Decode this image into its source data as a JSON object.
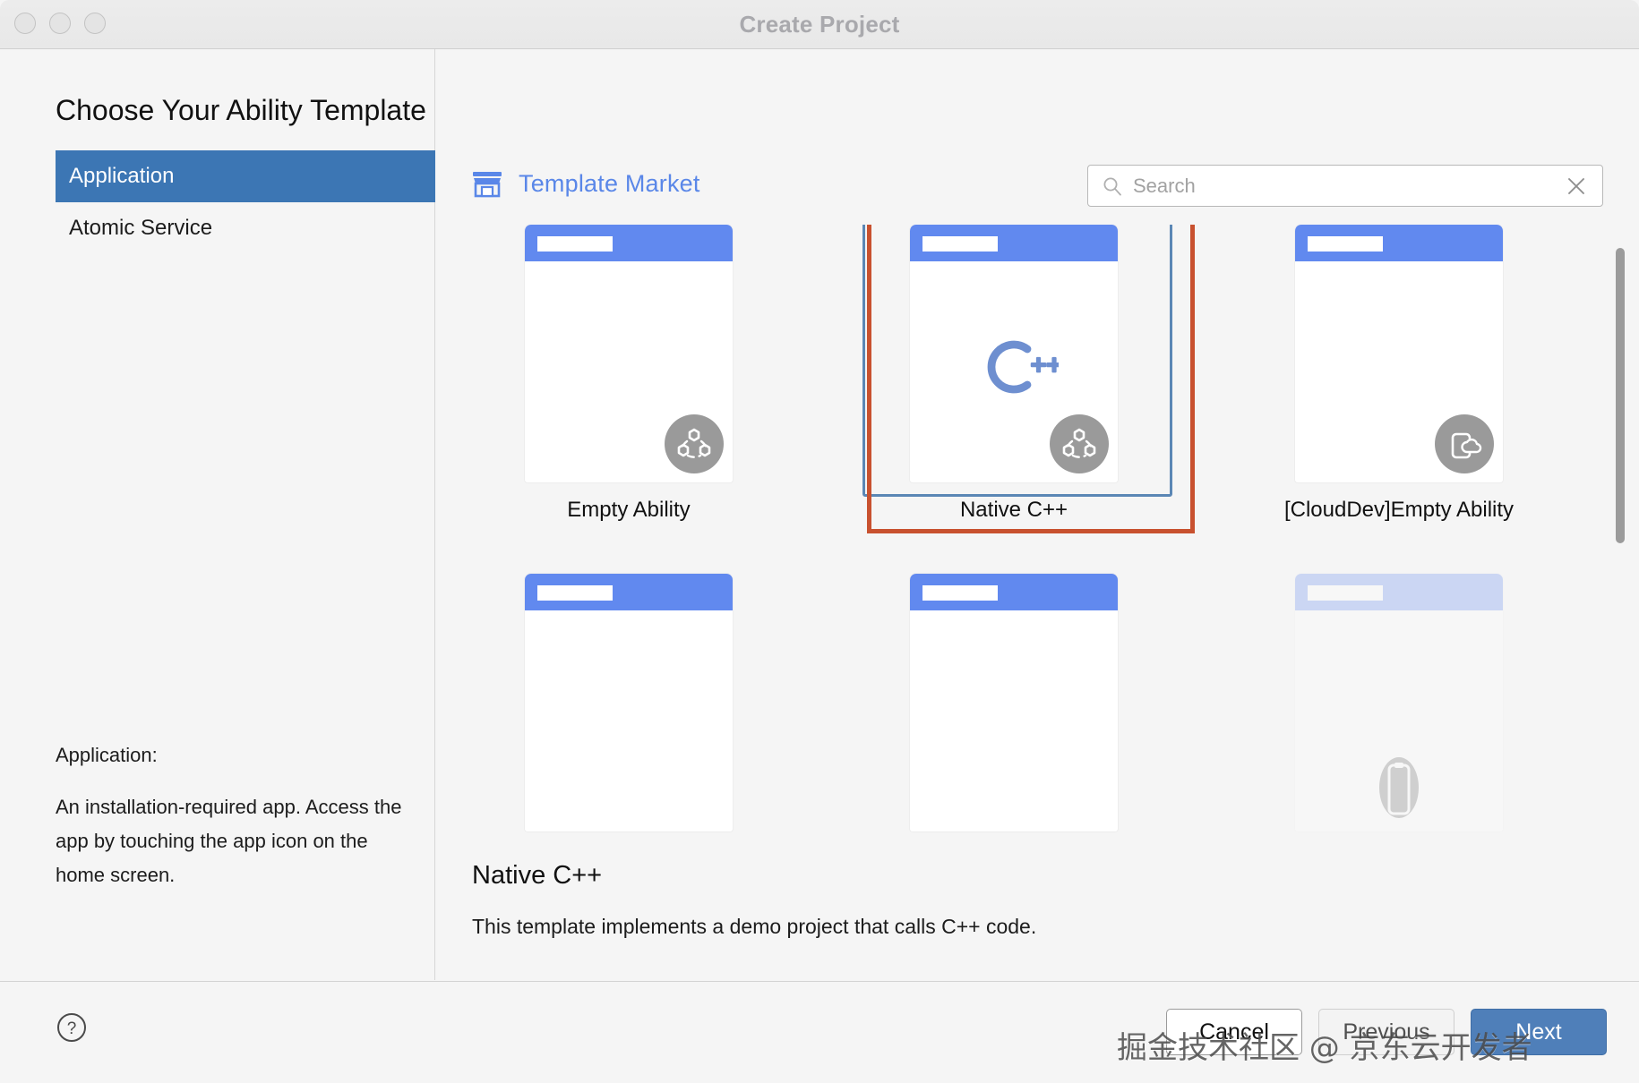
{
  "window": {
    "title": "Create Project",
    "traffic_lights": [
      "close-button",
      "minimize-button",
      "maximize-button"
    ]
  },
  "left_panel": {
    "heading": "Choose Your Ability Template",
    "categories": [
      {
        "label": "Application",
        "selected": true
      },
      {
        "label": "Atomic Service",
        "selected": false
      }
    ],
    "description_label": "Application:",
    "description_body": "An installation-required app. Access the app by touching the app icon on the home screen."
  },
  "right_panel": {
    "market_label": "Template Market",
    "market_icon": "store-icon",
    "search": {
      "placeholder": "Search",
      "value": "",
      "search_icon": "search-icon",
      "clear_icon": "close-icon"
    },
    "templates": [
      {
        "label": "Empty Ability",
        "badge_icon": "ability-hexagon-icon",
        "selected": false,
        "has_cpp_mark": false,
        "faded": false,
        "row": 1
      },
      {
        "label": "Native C++",
        "badge_icon": "ability-hexagon-icon",
        "selected": true,
        "has_cpp_mark": true,
        "faded": false,
        "row": 1
      },
      {
        "label": "[CloudDev]Empty Ability",
        "badge_icon": "phone-cloud-icon",
        "selected": false,
        "has_cpp_mark": false,
        "faded": false,
        "row": 1
      },
      {
        "label": "",
        "badge_icon": "",
        "selected": false,
        "has_cpp_mark": false,
        "faded": false,
        "row": 2
      },
      {
        "label": "",
        "badge_icon": "",
        "selected": false,
        "has_cpp_mark": false,
        "faded": false,
        "row": 2
      },
      {
        "label": "",
        "badge_icon": "phone-icon",
        "selected": false,
        "has_cpp_mark": false,
        "faded": true,
        "row": 2
      }
    ],
    "detail": {
      "title": "Native C++",
      "description": "This template implements a demo project that calls C++ code."
    },
    "scrollbar": {
      "visible": true
    }
  },
  "footer": {
    "help_icon": "question-mark-icon",
    "cancel_label": "Cancel",
    "previous_label": "Previous",
    "next_label": "Next"
  },
  "overlay": {
    "watermark": "掘金技术社区 @ 京东云开发者"
  },
  "colors": {
    "accent_blue": "#3c76b4",
    "template_blue": "#6189ef",
    "link_blue": "#5a87e8",
    "selection_orange": "#c8512f",
    "selection_blue": "#5b87b5",
    "next_button": "#4f7fb9"
  }
}
